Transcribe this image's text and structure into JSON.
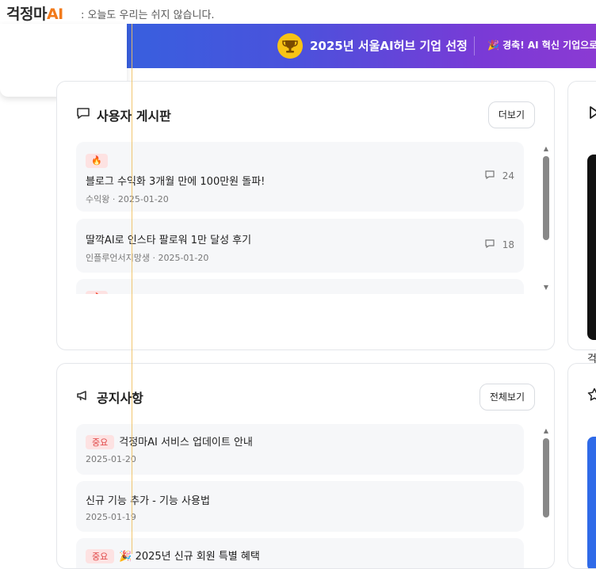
{
  "header": {
    "logo_main": "걱정마",
    "logo_ai": "AI",
    "slogan": ": 오늘도 우리는 쉬지 않습니다."
  },
  "banner": {
    "award_text": "2025년 서울AI허브 기업 선정",
    "party_text": "경축! AI 혁신 기업으로",
    "trophy_icon": "trophy-icon",
    "party_icon": "party-popper-icon"
  },
  "board": {
    "title": "사용자 게시판",
    "more_label": "더보기",
    "posts": [
      {
        "hot": true,
        "hot_icon": "fire-icon",
        "title": "블로그 수익화 3개월 만에 100만원 돌파!",
        "author": "수익왕",
        "date": "2025-01-20",
        "comments": "24",
        "meta": "수익왕 · 2025-01-20"
      },
      {
        "hot": false,
        "title": "딸깍AI로 인스타 팔로워 1만 달성 후기",
        "author": "인플루언서지망생",
        "date": "2025-01-20",
        "comments": "18",
        "meta": "인플루언서지망생 · 2025-01-20"
      },
      {
        "hot": true,
        "hot_icon": "fire-icon",
        "title": "",
        "meta": ""
      }
    ]
  },
  "notice": {
    "title": "공지사항",
    "more_label": "전체보기",
    "items": [
      {
        "important": true,
        "badge": "중요",
        "title": "걱정마AI 서비스 업데이트 안내",
        "date": "2025-01-20"
      },
      {
        "important": false,
        "title": "신규 기능 추가 - 기능 사용법",
        "date": "2025-01-19"
      },
      {
        "important": true,
        "badge": "중요",
        "title": "🎉 2025년 신규 회원 특별 혜택",
        "date": ""
      }
    ]
  },
  "right_panel": {
    "caption": "걱"
  },
  "colors": {
    "accent_orange": "#f27a1a",
    "banner_start": "#2f66e0",
    "banner_end": "#8b3ad3",
    "badge_red": "#e04444"
  }
}
